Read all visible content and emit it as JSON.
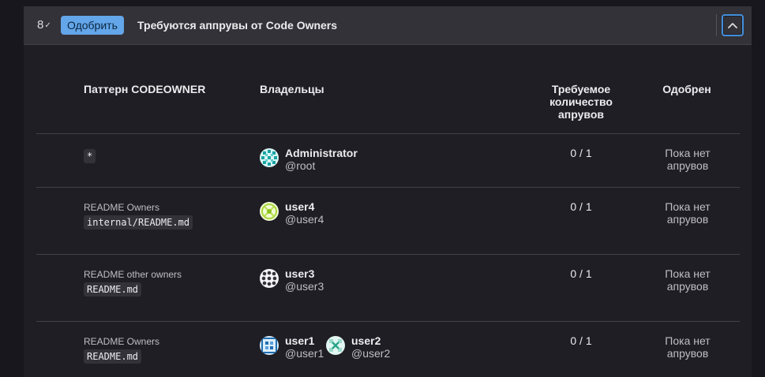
{
  "header": {
    "approvals_count": "8",
    "approve_label": "Одобрить",
    "title": "Требуются аппрувы от Code Owners"
  },
  "table": {
    "columns": {
      "pattern": "Паттерн CODEOWNER",
      "owners": "Владельцы",
      "required": [
        "Требуемое",
        "количество",
        "апрувов"
      ],
      "approved": "Одобрен"
    },
    "rows": [
      {
        "label": "",
        "pattern": "*",
        "owners": [
          {
            "name": "Administrator",
            "username": "@root"
          }
        ],
        "count": "0 / 1",
        "status": [
          "Пока нет",
          "апрувов"
        ]
      },
      {
        "label": "README Owners",
        "pattern": "internal/README.md",
        "owners": [
          {
            "name": "user4",
            "username": "@user4"
          }
        ],
        "count": "0 / 1",
        "status": [
          "Пока нет",
          "апрувов"
        ]
      },
      {
        "label": "README other owners",
        "pattern": "README.md",
        "owners": [
          {
            "name": "user3",
            "username": "@user3"
          }
        ],
        "count": "0 / 1",
        "status": [
          "Пока нет",
          "апрувов"
        ]
      },
      {
        "label": "README Owners",
        "pattern": "README.md",
        "owners": [
          {
            "name": "user1",
            "username": "@user1"
          },
          {
            "name": "user2",
            "username": "@user2"
          }
        ],
        "count": "0 / 1",
        "status": [
          "Пока нет",
          "апрувов"
        ]
      }
    ]
  },
  "colors": {
    "accent": "#63a6e9",
    "focus": "#428fdc",
    "header_bg": "#333238",
    "panel_bg": "#1f1e24"
  }
}
